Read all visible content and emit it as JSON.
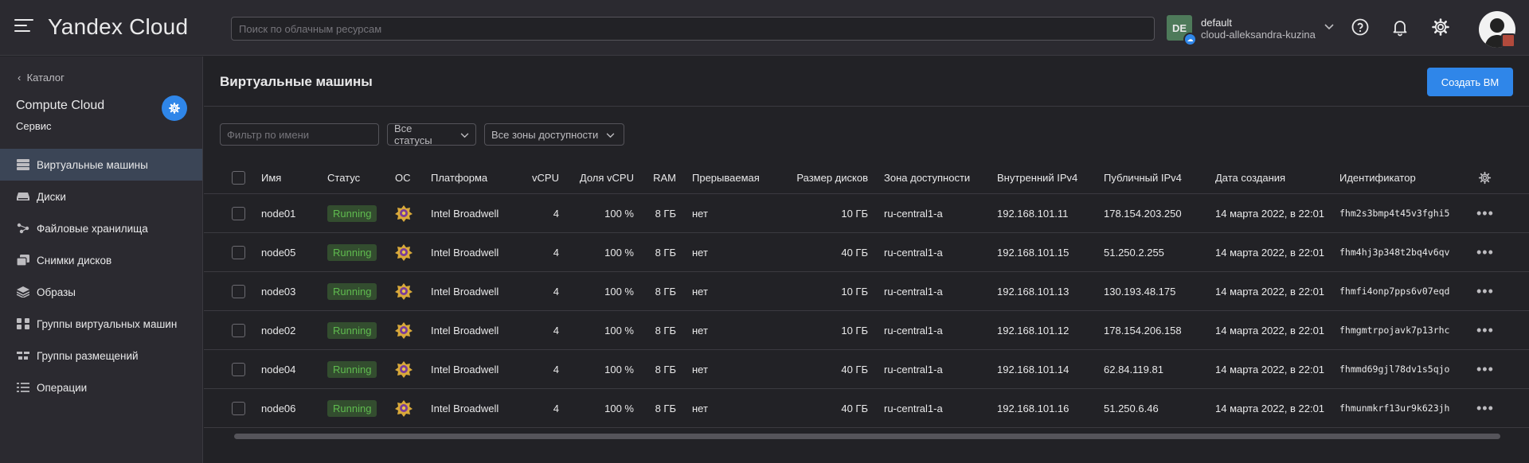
{
  "header": {
    "logo": "Yandex Cloud",
    "search_placeholder": "Поиск по облачным ресурсам",
    "account": {
      "initials": "DE",
      "folder": "default",
      "cloud": "cloud-alleksandra-kuzina"
    }
  },
  "sidebar": {
    "back_label": "Каталог",
    "service_title": "Compute Cloud",
    "service_subtitle": "Сервис",
    "items": [
      {
        "label": "Виртуальные машины",
        "icon": "vm-icon",
        "active": true
      },
      {
        "label": "Диски",
        "icon": "disk-icon"
      },
      {
        "label": "Файловые хранилища",
        "icon": "filestore-icon"
      },
      {
        "label": "Снимки дисков",
        "icon": "snapshot-icon"
      },
      {
        "label": "Образы",
        "icon": "image-layers-icon"
      },
      {
        "label": "Группы виртуальных машин",
        "icon": "instance-group-icon"
      },
      {
        "label": "Группы размещений",
        "icon": "placement-group-icon"
      },
      {
        "label": "Операции",
        "icon": "operations-icon"
      }
    ]
  },
  "main": {
    "title": "Виртуальные машины",
    "create_button": "Создать ВМ",
    "filter_placeholder": "Фильтр по имени",
    "status_filter": "Все статусы",
    "zone_filter": "Все зоны доступности",
    "columns": [
      "Имя",
      "Статус",
      "ОС",
      "Платформа",
      "vCPU",
      "Доля vCPU",
      "RAM",
      "Прерываемая",
      "Размер дисков",
      "Зона доступности",
      "Внутренний IPv4",
      "Публичный IPv4",
      "Дата создания",
      "Идентификатор"
    ],
    "rows": [
      [
        "node01",
        "Running",
        "Intel Broadwell",
        "4",
        "100 %",
        "8 ГБ",
        "нет",
        "10 ГБ",
        "ru-central1-a",
        "192.168.101.11",
        "178.154.203.250",
        "14 марта 2022, в 22:01",
        "fhm2s3bmp4t45v3fghi5"
      ],
      [
        "node05",
        "Running",
        "Intel Broadwell",
        "4",
        "100 %",
        "8 ГБ",
        "нет",
        "40 ГБ",
        "ru-central1-a",
        "192.168.101.15",
        "51.250.2.255",
        "14 марта 2022, в 22:01",
        "fhm4hj3p348t2bq4v6qv"
      ],
      [
        "node03",
        "Running",
        "Intel Broadwell",
        "4",
        "100 %",
        "8 ГБ",
        "нет",
        "10 ГБ",
        "ru-central1-a",
        "192.168.101.13",
        "130.193.48.175",
        "14 марта 2022, в 22:01",
        "fhmfi4onp7pps6v07eqd"
      ],
      [
        "node02",
        "Running",
        "Intel Broadwell",
        "4",
        "100 %",
        "8 ГБ",
        "нет",
        "10 ГБ",
        "ru-central1-a",
        "192.168.101.12",
        "178.154.206.158",
        "14 марта 2022, в 22:01",
        "fhmgmtrpojavk7p13rhc"
      ],
      [
        "node04",
        "Running",
        "Intel Broadwell",
        "4",
        "100 %",
        "8 ГБ",
        "нет",
        "40 ГБ",
        "ru-central1-a",
        "192.168.101.14",
        "62.84.119.81",
        "14 марта 2022, в 22:01",
        "fhmmd69gjl78dv1s5qjo"
      ],
      [
        "node06",
        "Running",
        "Intel Broadwell",
        "4",
        "100 %",
        "8 ГБ",
        "нет",
        "40 ГБ",
        "ru-central1-a",
        "192.168.101.16",
        "51.250.6.46",
        "14 марта 2022, в 22:01",
        "fhmunmkrf13ur9k623jh"
      ]
    ]
  },
  "colors": {
    "accent": "#2f86e9",
    "running_bg": "#334d2f",
    "running_text": "#5fbb4f"
  }
}
